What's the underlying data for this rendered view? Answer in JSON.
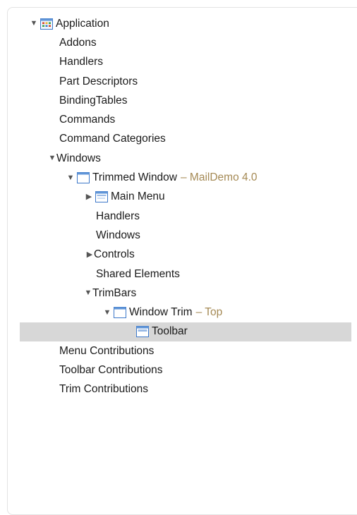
{
  "tree": {
    "application": {
      "label": "Application"
    },
    "items": {
      "addons": "Addons",
      "handlers": "Handlers",
      "part_descriptors": "Part Descriptors",
      "binding_tables": "BindingTables",
      "commands": "Commands",
      "command_categories": "Command Categories"
    },
    "windows": {
      "label": "Windows"
    },
    "trimmed_window": {
      "label": "Trimmed Window",
      "suffix": "– MailDemo 4.0"
    },
    "tw_children": {
      "main_menu": "Main Menu",
      "handlers": "Handlers",
      "windows": "Windows",
      "controls": "Controls",
      "shared_elements": "Shared Elements",
      "trimbars": "TrimBars"
    },
    "window_trim": {
      "label": "Window Trim",
      "suffix": "– Top"
    },
    "toolbar": {
      "label": "Toolbar",
      "selected": true
    },
    "contributions": {
      "menu": "Menu Contributions",
      "toolbar": "Toolbar Contributions",
      "trim": "Trim Contributions"
    }
  },
  "icons": {
    "application": "application-grid-icon",
    "trimmed_window": "window-icon",
    "main_menu": "menu-bar-icon",
    "window_trim": "window-icon",
    "toolbar": "toolbar-icon"
  },
  "colors": {
    "selection": "#d7d7d7",
    "suffix_text": "#a58a55",
    "icon_blue": "#3d78c9"
  }
}
